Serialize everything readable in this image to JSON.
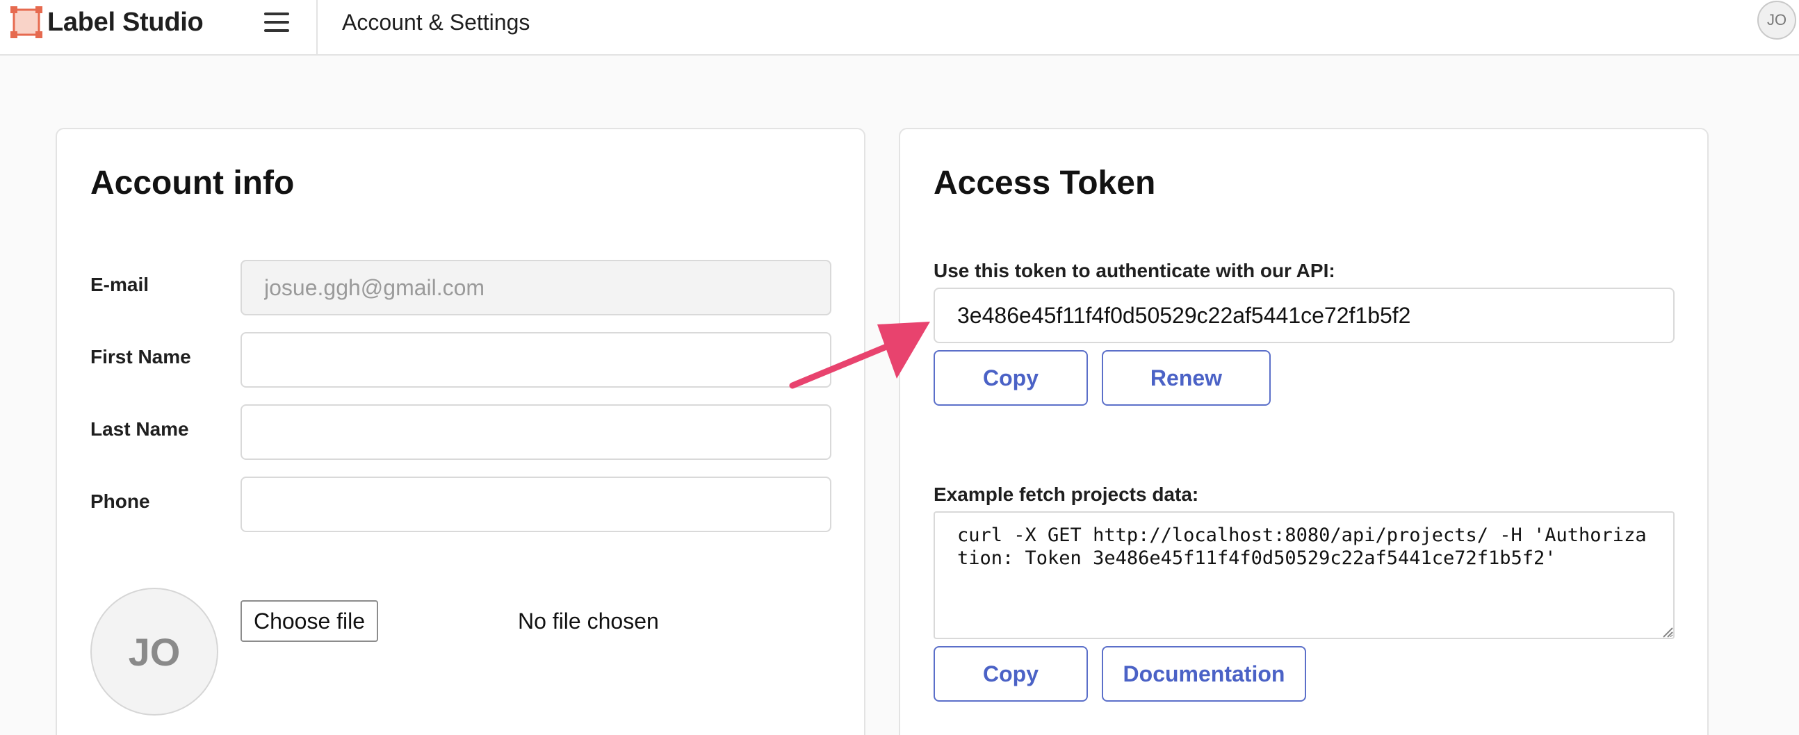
{
  "header": {
    "brand": "Label Studio",
    "page_title": "Account & Settings",
    "user_initials": "JO"
  },
  "account": {
    "title": "Account info",
    "fields": {
      "email_label": "E-mail",
      "email_value": "josue.ggh@gmail.com",
      "first_name_label": "First Name",
      "first_name_value": "",
      "last_name_label": "Last Name",
      "last_name_value": "",
      "phone_label": "Phone",
      "phone_value": ""
    },
    "avatar_initials": "JO",
    "choose_file_label": "Choose file",
    "no_file_text": "No file chosen"
  },
  "token": {
    "title": "Access Token",
    "use_label": "Use this token to authenticate with our API:",
    "token_value": "3e486e45f11f4f0d50529c22af5441ce72f1b5f2",
    "copy_label": "Copy",
    "renew_label": "Renew",
    "example_label": "Example fetch projects data:",
    "curl_example": "curl -X GET http://localhost:8080/api/projects/ -H 'Authorization: Token 3e486e45f11f4f0d50529c22af5441ce72f1b5f2'",
    "copy_label_2": "Copy",
    "documentation_label": "Documentation"
  },
  "colors": {
    "accent": "#4b62c6",
    "arrow": "#e8436e",
    "logo": "#e66a4f"
  }
}
